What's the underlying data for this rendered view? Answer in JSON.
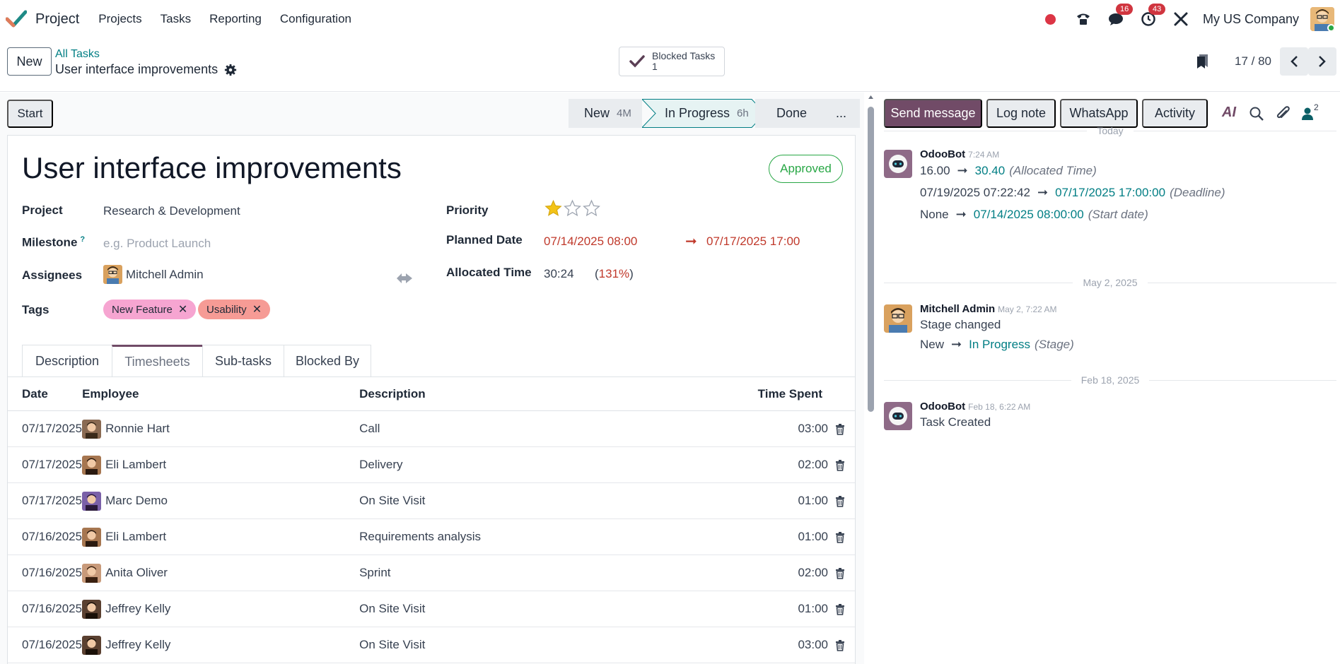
{
  "navbar": {
    "app_name": "Project",
    "menu": [
      "Projects",
      "Tasks",
      "Reporting",
      "Configuration"
    ],
    "chat_badge": "16",
    "activity_badge": "43",
    "company": "My US Company"
  },
  "control": {
    "new_label": "New",
    "breadcrumb_parent": "All Tasks",
    "breadcrumb_current": "User interface improvements",
    "smart_button_label": "Blocked Tasks",
    "smart_button_count": "1",
    "pager": "17 / 80"
  },
  "statusbar": {
    "start_label": "Start",
    "stages": [
      {
        "label": "New",
        "duration": "4M"
      },
      {
        "label": "In Progress",
        "duration": "6h"
      },
      {
        "label": "Done",
        "duration": ""
      },
      {
        "label": "...",
        "duration": ""
      }
    ]
  },
  "form": {
    "title": "User interface improvements",
    "approved": "Approved",
    "project_label": "Project",
    "project_value": "Research & Development",
    "milestone_label": "Milestone",
    "milestone_sup": "?",
    "milestone_placeholder": "e.g. Product Launch",
    "assignees_label": "Assignees",
    "assignee": "Mitchell Admin",
    "tags_label": "Tags",
    "tags": [
      "New Feature",
      "Usability"
    ],
    "priority_label": "Priority",
    "priority_stars": 1,
    "planned_label": "Planned Date",
    "planned_start": "07/14/2025 08:00",
    "planned_end": "07/17/2025 17:00",
    "allocated_label": "Allocated Time",
    "allocated_value": "30:24",
    "allocated_pct": "131%",
    "allocated_paren_open": "(",
    "allocated_paren_close": ")",
    "tag_remove": "✕",
    "date_arrow": "➞"
  },
  "tabs": [
    "Description",
    "Timesheets",
    "Sub-tasks",
    "Blocked By"
  ],
  "timesheet": {
    "headers": [
      "Date",
      "Employee",
      "Description",
      "Time Spent"
    ],
    "rows": [
      {
        "date": "07/17/2025",
        "employee": "Ronnie Hart",
        "description": "Call",
        "time": "03:00"
      },
      {
        "date": "07/17/2025",
        "employee": "Eli Lambert",
        "description": "Delivery",
        "time": "02:00"
      },
      {
        "date": "07/17/2025",
        "employee": "Marc Demo",
        "description": "On Site Visit",
        "time": "01:00"
      },
      {
        "date": "07/16/2025",
        "employee": "Eli Lambert",
        "description": "Requirements analysis",
        "time": "01:00"
      },
      {
        "date": "07/16/2025",
        "employee": "Anita Oliver",
        "description": "Sprint",
        "time": "02:00"
      },
      {
        "date": "07/16/2025",
        "employee": "Jeffrey Kelly",
        "description": "On Site Visit",
        "time": "01:00"
      },
      {
        "date": "07/16/2025",
        "employee": "Jeffrey Kelly",
        "description": "On Site Visit",
        "time": "03:00"
      }
    ]
  },
  "chatter": {
    "send_message": "Send message",
    "log_note": "Log note",
    "whatsapp": "WhatsApp",
    "activity": "Activity",
    "ai_label": "AI",
    "followers_count": "2",
    "arrow": "➞",
    "sep_today": "Today",
    "sep_may": "May 2, 2025",
    "sep_feb": "Feb 18, 2025",
    "msg1": {
      "author": "OdooBot",
      "time": "7:24 AM",
      "changes": [
        {
          "old": "16.00",
          "new": "30.40",
          "field": "(Allocated Time)"
        },
        {
          "old": "07/19/2025 07:22:42",
          "new": "07/17/2025 17:00:00",
          "field": "(Deadline)"
        },
        {
          "old": "None",
          "new": "07/14/2025 08:00:00",
          "field": "(Start date)"
        }
      ]
    },
    "msg2": {
      "author": "Mitchell Admin",
      "time": "May 2, 7:22 AM",
      "body": "Stage changed",
      "change": {
        "old": "New",
        "new": "In Progress",
        "field": "(Stage)"
      }
    },
    "msg3": {
      "author": "OdooBot",
      "time": "Feb 18, 6:22 AM",
      "body": "Task Created"
    }
  },
  "colors": {
    "brand": "#714b67",
    "link": "#017e84",
    "approved": "#28a745",
    "badge": "#d0353f"
  }
}
